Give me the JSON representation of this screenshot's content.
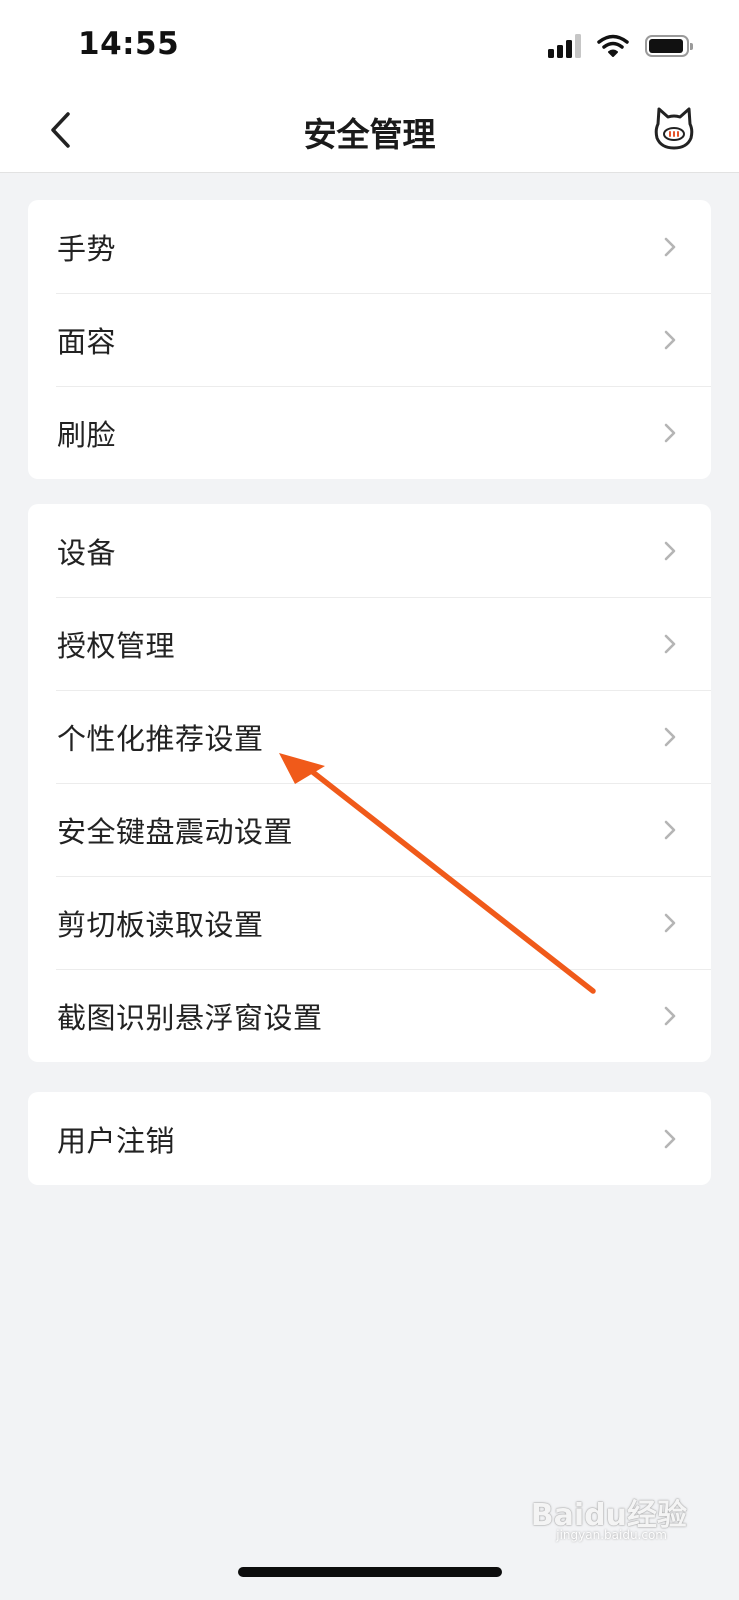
{
  "status_bar": {
    "time": "14:55"
  },
  "nav": {
    "title": "安全管理",
    "back_icon": "chevron-left-icon",
    "right_icon": "cat-mascot-icon"
  },
  "groups": [
    {
      "items": [
        {
          "label": "手势"
        },
        {
          "label": "面容"
        },
        {
          "label": "刷脸"
        }
      ]
    },
    {
      "items": [
        {
          "label": "设备"
        },
        {
          "label": "授权管理"
        },
        {
          "label": "个性化推荐设置"
        },
        {
          "label": "安全键盘震动设置"
        },
        {
          "label": "剪切板读取设置"
        },
        {
          "label": "截图识别悬浮窗设置"
        }
      ]
    },
    {
      "items": [
        {
          "label": "用户注销"
        }
      ]
    }
  ],
  "annotation": {
    "color": "#f05a1a"
  },
  "watermark": {
    "text": "Baidu经验",
    "sub": "jingyan.baidu.com"
  }
}
